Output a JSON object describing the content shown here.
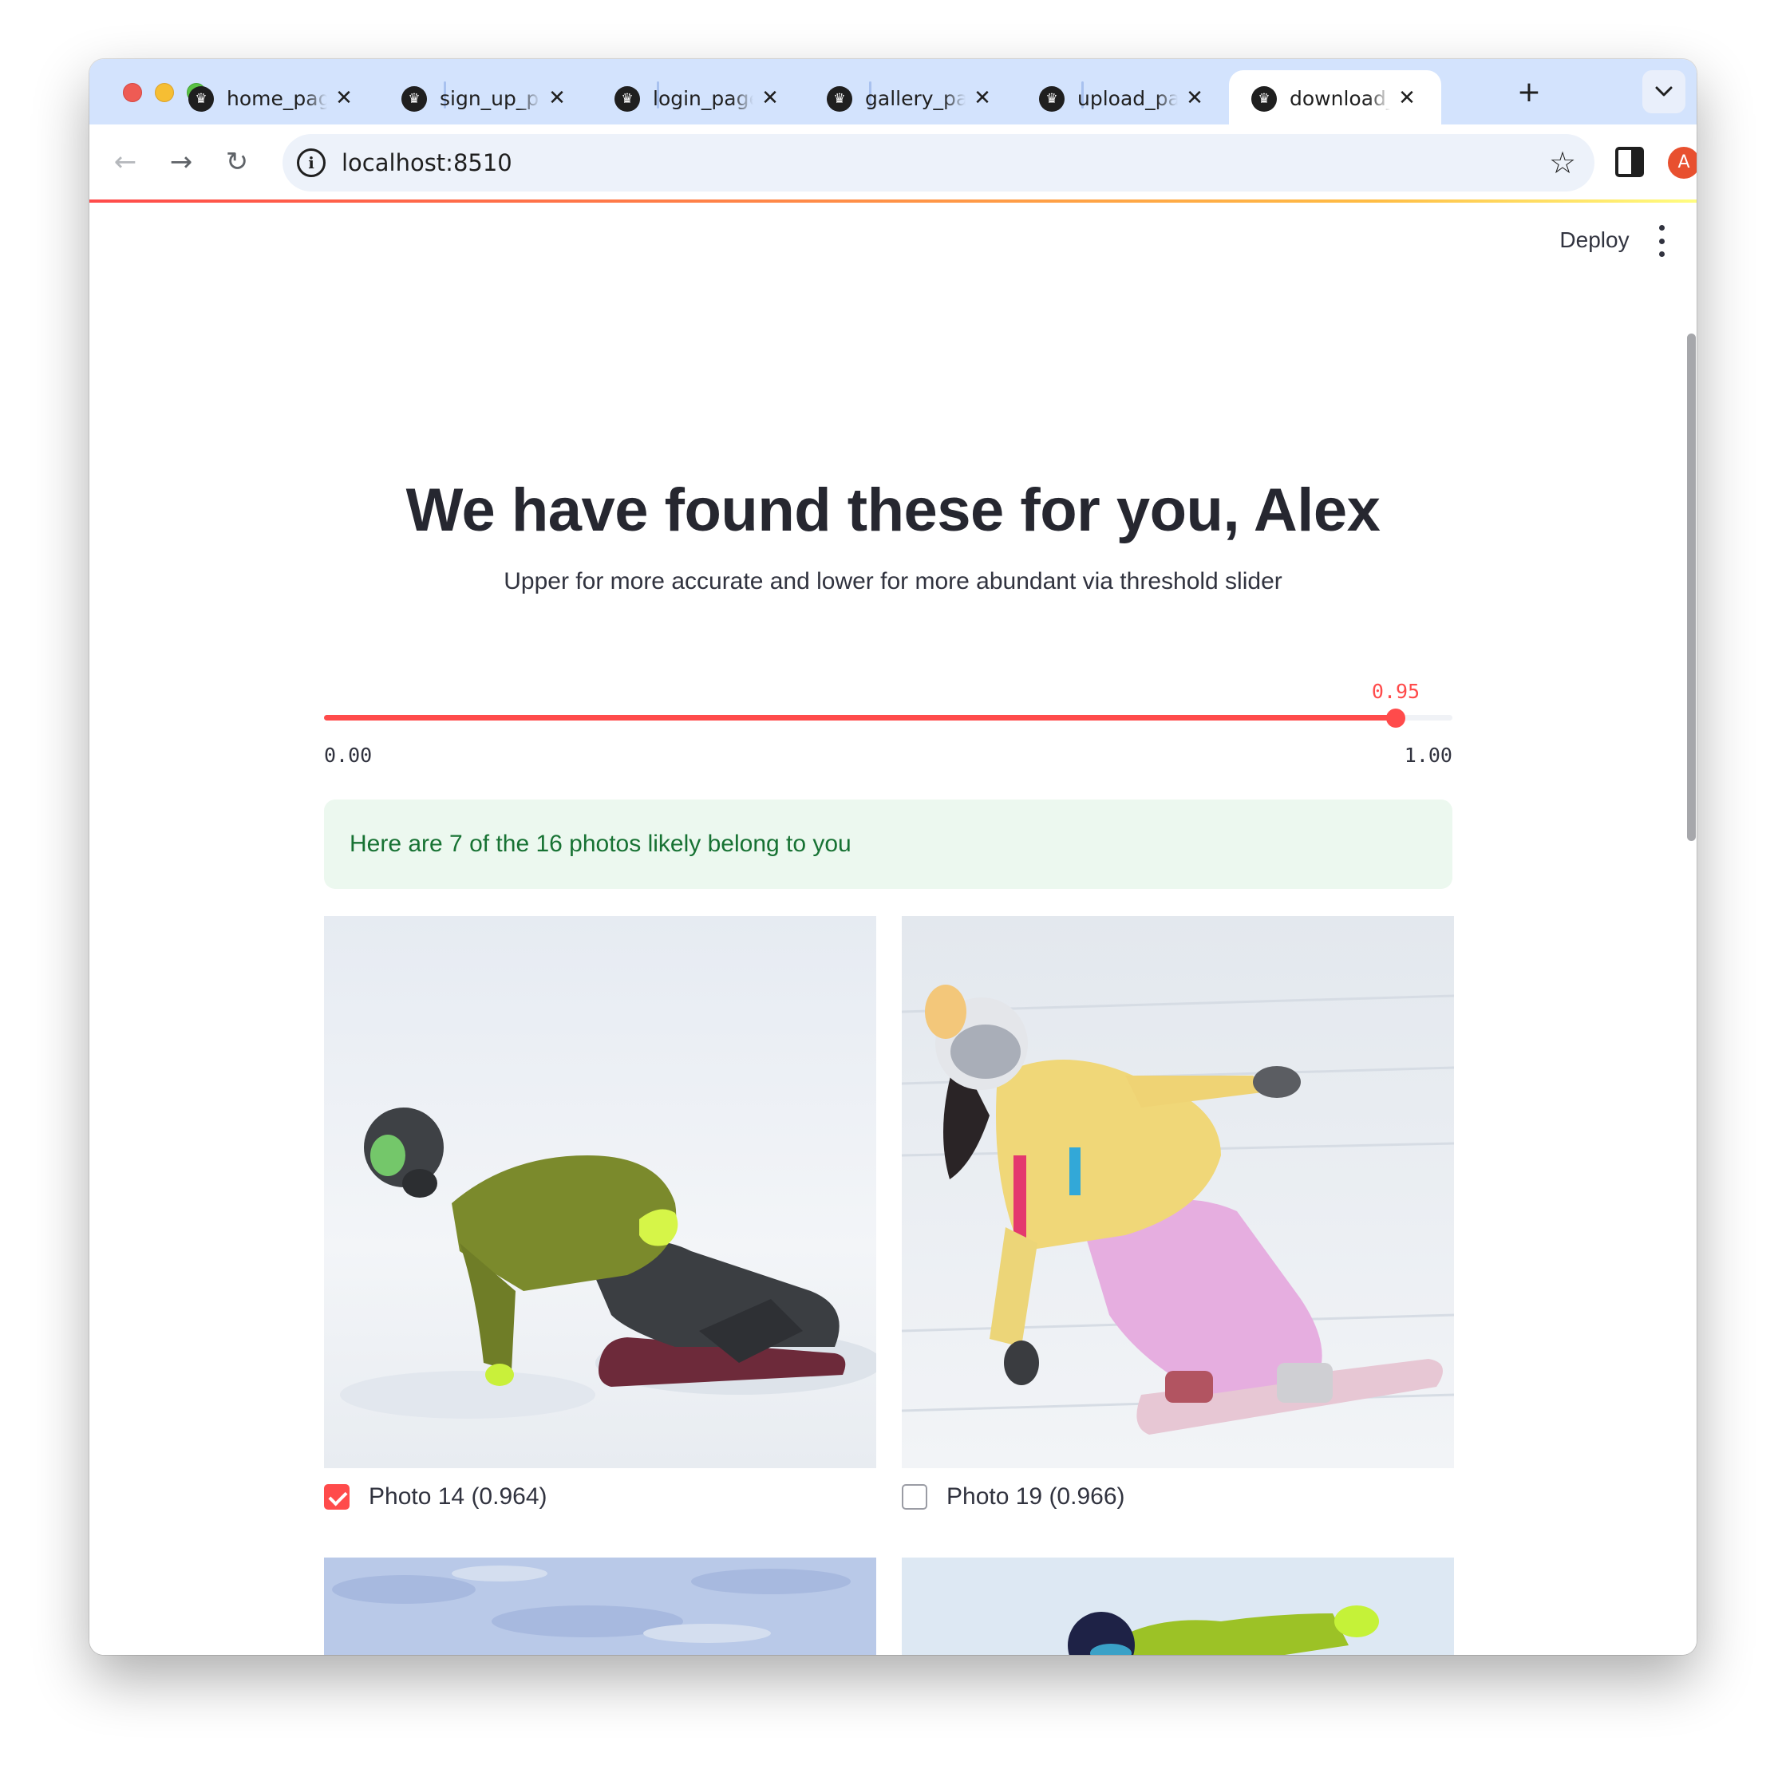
{
  "browser": {
    "tabs": [
      {
        "title": "home_page"
      },
      {
        "title": "sign_up_page"
      },
      {
        "title": "login_page"
      },
      {
        "title": "gallery_page"
      },
      {
        "title": "upload_page"
      },
      {
        "title": "download_page",
        "active": true
      }
    ],
    "close_glyph": "✕",
    "newtab_glyph": "+",
    "tabsearch_glyph": "⌄",
    "url": "localhost:8510",
    "back_glyph": "←",
    "forward_glyph": "→",
    "reload_glyph": "↻",
    "star_glyph": "☆",
    "info_glyph": "i",
    "avatar_initial": "A",
    "icons": {
      "favicon": "crown-icon",
      "info": "info-icon",
      "bookmark": "star-icon",
      "sidepanel": "side-panel-icon",
      "menu": "more-vert-icon"
    }
  },
  "app": {
    "deploy_label": "Deploy",
    "title": "We have found these for you, Alex",
    "subtitle": "Upper for more accurate and lower for more abundant via threshold slider",
    "slider": {
      "value": 0.95,
      "value_label": "0.95",
      "min": 0,
      "max": 1,
      "min_label": "0.00",
      "max_label": "1.00"
    },
    "alert_text": "Here are 7 of the 16 photos likely belong to you",
    "photos": [
      {
        "label": "Photo 14 (0.964)",
        "checked": true
      },
      {
        "label": "Photo 19 (0.966)",
        "checked": false
      }
    ],
    "colors": {
      "accent": "#ff4b4b",
      "heading": "#262730",
      "text": "#31333f",
      "alert_bg": "#ecf8ef",
      "alert_text": "#177233",
      "tabstrip": "#d3e3fd",
      "avatar": "#e8502f"
    }
  }
}
